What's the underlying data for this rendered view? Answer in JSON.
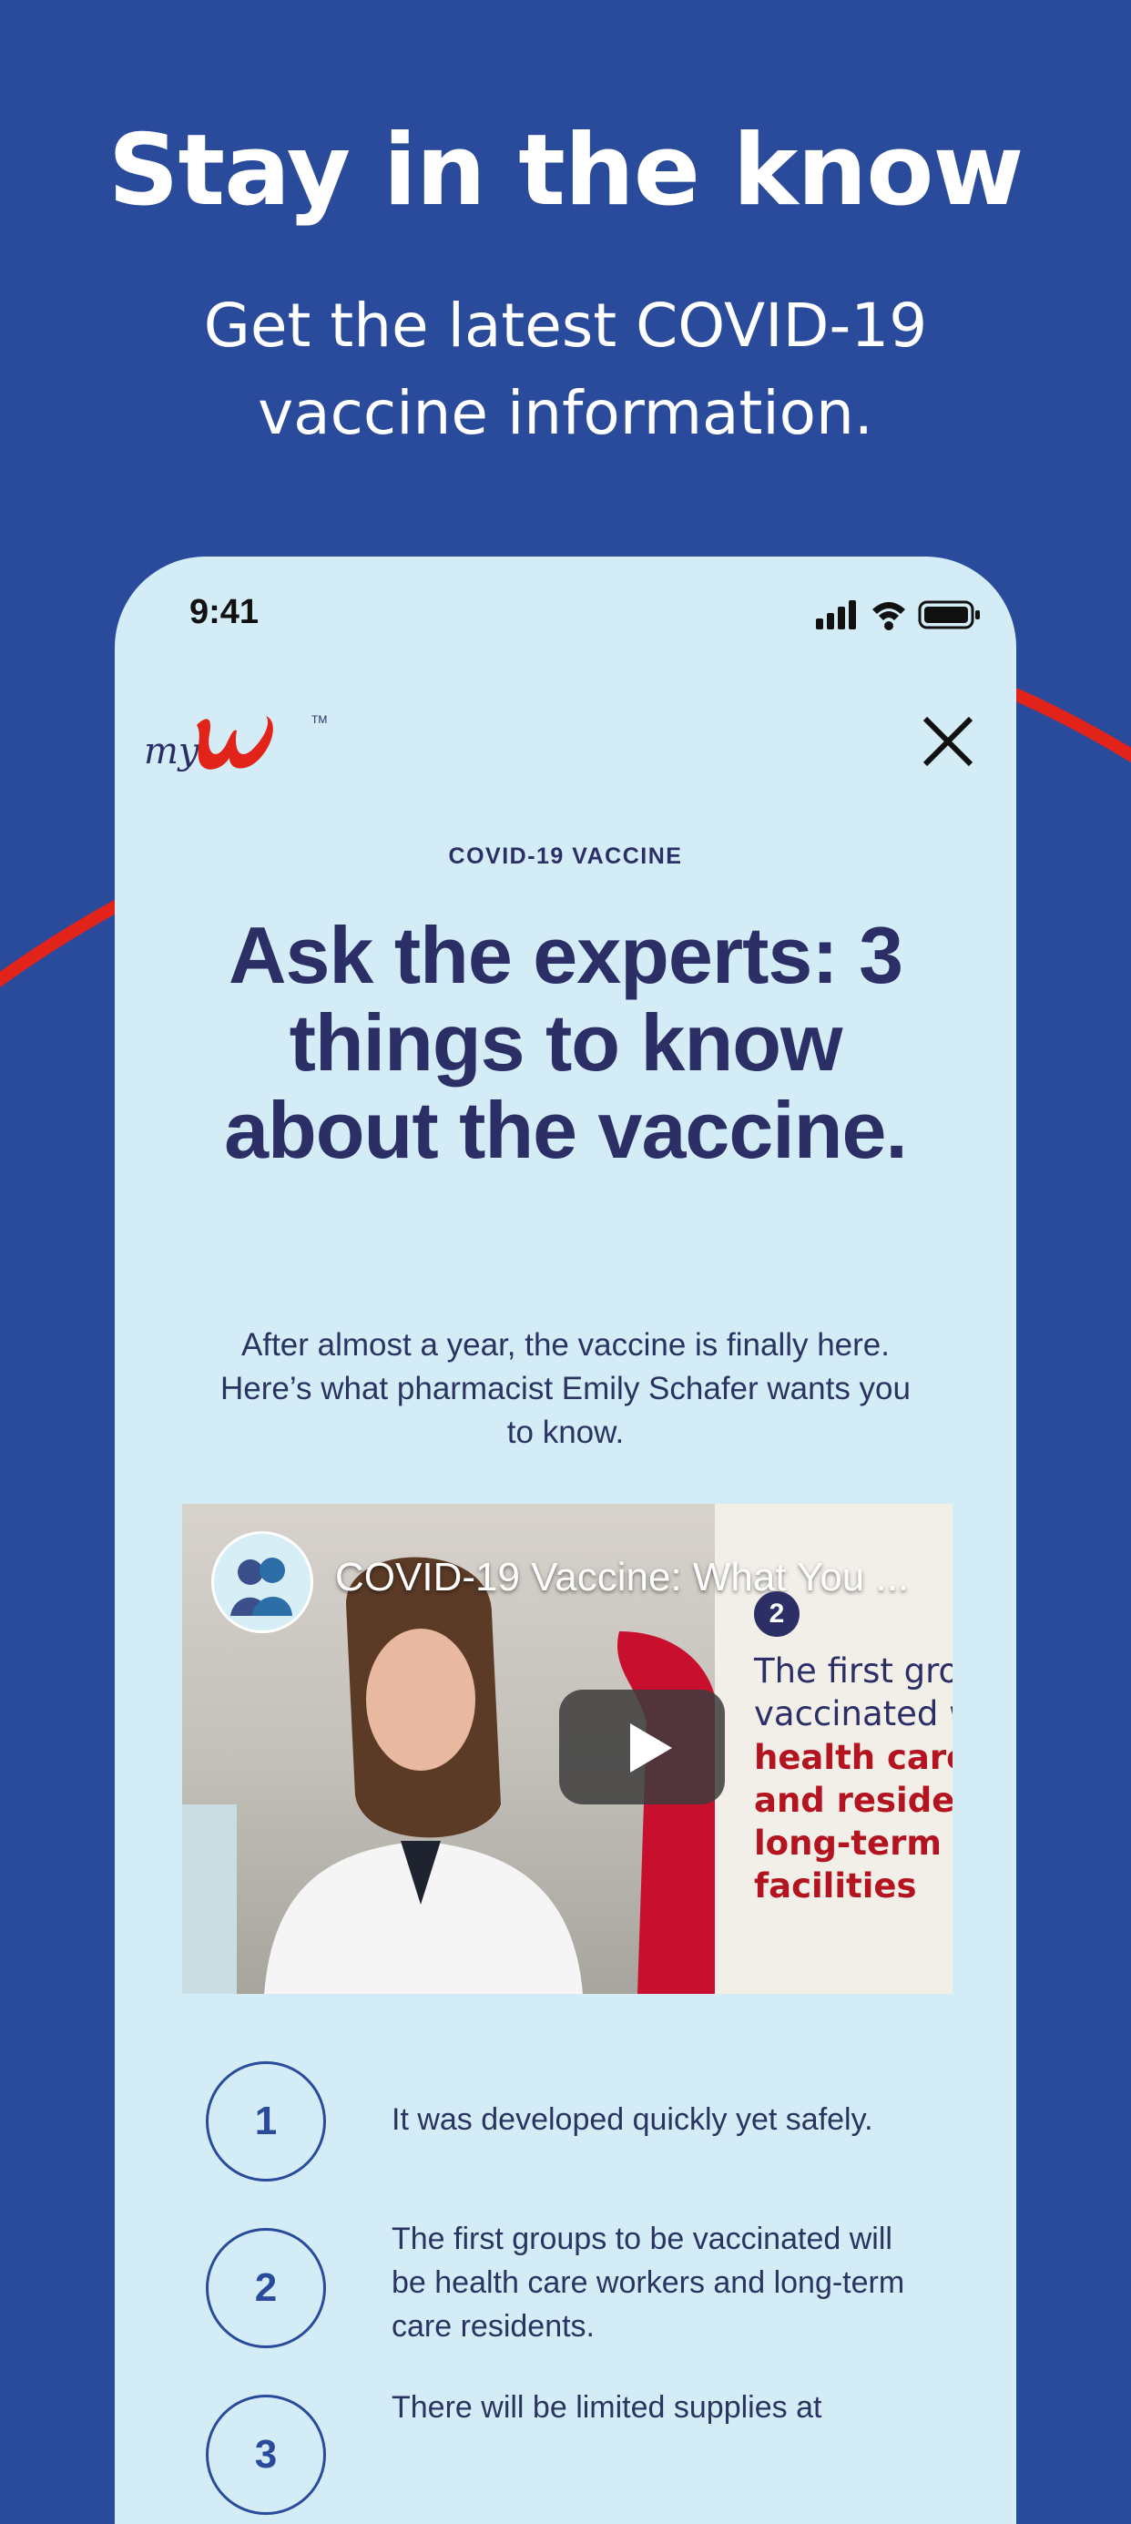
{
  "promo": {
    "title": "Stay in the know",
    "subtitle": "Get the latest COVID-19 vaccine information."
  },
  "colors": {
    "background": "#2a4b9b",
    "card": "#d3ecf6",
    "headline": "#2b2f66",
    "accent_red": "#e2231a"
  },
  "status_bar": {
    "time": "9:41",
    "icons": [
      "signal-icon",
      "wifi-icon",
      "battery-icon"
    ]
  },
  "header": {
    "logo_text": "myW",
    "close_icon": "close-icon"
  },
  "article": {
    "eyebrow": "COVID-19 VACCINE",
    "headline": "Ask the experts: 3 things to know about the vaccine.",
    "intro": "After almost a year, the vaccine is finally here. Here’s what pharmacist Emily Schafer wants you to know."
  },
  "video": {
    "title": "COVID-19 Vaccine: What You ...",
    "slide_number": "2",
    "slide_text": "The first grou\nvaccinated wi",
    "slide_text_highlight": "health care w\nand resident\nlong-term ca\nfacilities",
    "play_icon": "play-icon"
  },
  "list": [
    {
      "number": "1",
      "text": "It was developed quickly yet safely."
    },
    {
      "number": "2",
      "text": "The first groups to be vaccinated will be health care workers and long-term care residents."
    },
    {
      "number": "3",
      "text": "There will be limited supplies at"
    }
  ]
}
